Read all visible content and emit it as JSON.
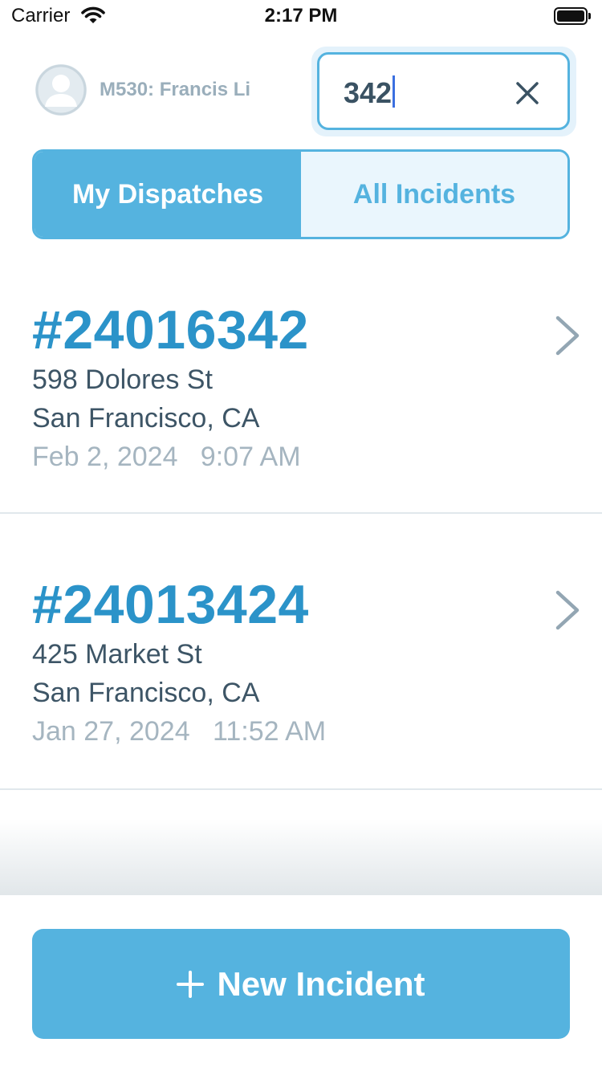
{
  "status_bar": {
    "carrier": "Carrier",
    "time": "2:17 PM"
  },
  "user": {
    "name": "M530: Francis Li",
    "avatar_icon": "person-placeholder-icon"
  },
  "search": {
    "value": "342",
    "clear_icon": "close-icon"
  },
  "tabs": [
    {
      "label": "My Dispatches",
      "active": true
    },
    {
      "label": "All Incidents",
      "active": false
    }
  ],
  "incidents": [
    {
      "number": "#24016342",
      "street": "598 Dolores St",
      "city": "San Francisco, CA",
      "datetime": "Feb 2, 2024   9:07 AM"
    },
    {
      "number": "#24013424",
      "street": "425 Market St",
      "city": "San Francisco, CA",
      "datetime": "Jan 27, 2024   11:52 AM"
    }
  ],
  "new_incident": {
    "label": "New Incident",
    "icon": "plus-icon"
  },
  "colors": {
    "accent": "#55b3df",
    "incident_number": "#2b93c9",
    "text": "#3d5566",
    "muted": "#a5b5c0"
  }
}
